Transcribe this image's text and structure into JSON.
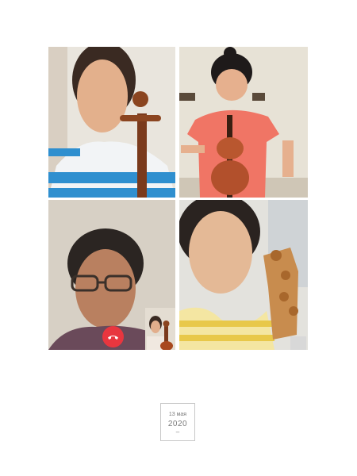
{
  "video_call": {
    "participants": [
      {
        "id": "participant-1"
      },
      {
        "id": "participant-2"
      },
      {
        "id": "participant-3"
      },
      {
        "id": "participant-4"
      }
    ],
    "end_call_icon": "phone-hangup-icon",
    "end_call_color": "#e8363f"
  },
  "post_date": {
    "day_month": "13 мая",
    "year": "2020",
    "separator": "–"
  }
}
